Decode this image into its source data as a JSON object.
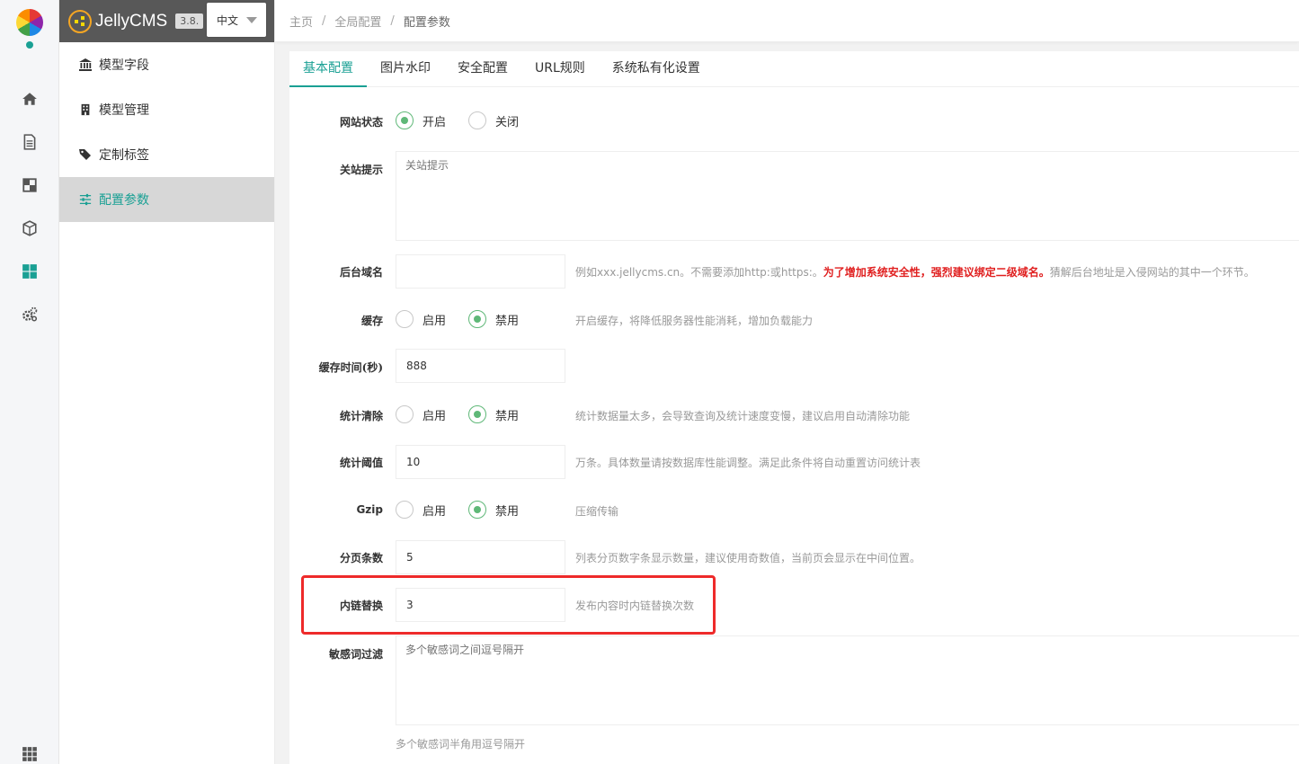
{
  "app": {
    "name": "JellyCMS",
    "version": "3.8.",
    "language": "中文"
  },
  "menu": {
    "items": [
      {
        "label": "模型字段"
      },
      {
        "label": "模型管理"
      },
      {
        "label": "定制标签"
      },
      {
        "label": "配置参数"
      }
    ]
  },
  "breadcrumb": {
    "items": [
      "主页",
      "全局配置",
      "配置参数"
    ],
    "sep": "/"
  },
  "tabs": [
    "基本配置",
    "图片水印",
    "安全配置",
    "URL规则",
    "系统私有化设置"
  ],
  "form": {
    "site_status": {
      "label": "网站状态",
      "options": [
        "开启",
        "关闭"
      ],
      "selected": "开启"
    },
    "close_tip": {
      "label": "关站提示",
      "placeholder": "关站提示"
    },
    "admin_domain": {
      "label": "后台域名",
      "value": "",
      "hint_pre": "例如xxx.jellycms.cn。不需要添加http:或https:。",
      "hint_warn": "为了增加系统安全性，强烈建议绑定二级域名。",
      "hint_post": "猜解后台地址是入侵网站的其中一个环节。"
    },
    "cache": {
      "label": "缓存",
      "options": [
        "启用",
        "禁用"
      ],
      "selected": "禁用",
      "hint": "开启缓存，将降低服务器性能消耗，增加负载能力"
    },
    "cache_time": {
      "label": "缓存时间(秒)",
      "value": "888"
    },
    "stat_clear": {
      "label": "统计清除",
      "options": [
        "启用",
        "禁用"
      ],
      "selected": "禁用",
      "hint": "统计数据量太多，会导致查询及统计速度变慢，建议启用自动清除功能"
    },
    "stat_threshold": {
      "label": "统计阈值",
      "value": "10",
      "hint": "万条。具体数量请按数据库性能调整。满足此条件将自动重置访问统计表"
    },
    "gzip": {
      "label": "Gzip",
      "options": [
        "启用",
        "禁用"
      ],
      "selected": "禁用",
      "hint": "压缩传输"
    },
    "page_count": {
      "label": "分页条数",
      "value": "5",
      "hint": "列表分页数字条显示数量，建议使用奇数值，当前页会显示在中间位置。"
    },
    "inner_link": {
      "label": "内链替换",
      "value": "3",
      "hint": "发布内容时内链替换次数"
    },
    "sensitive_words": {
      "label": "敏感词过滤",
      "placeholder": "多个敏感词之间逗号隔开",
      "hint": "多个敏感词半角用逗号隔开"
    }
  },
  "colors": {
    "accent": "#1aa094",
    "radio_on": "#5fb878",
    "warn": "#e02020",
    "highlight_box": "#ee2a2a"
  }
}
